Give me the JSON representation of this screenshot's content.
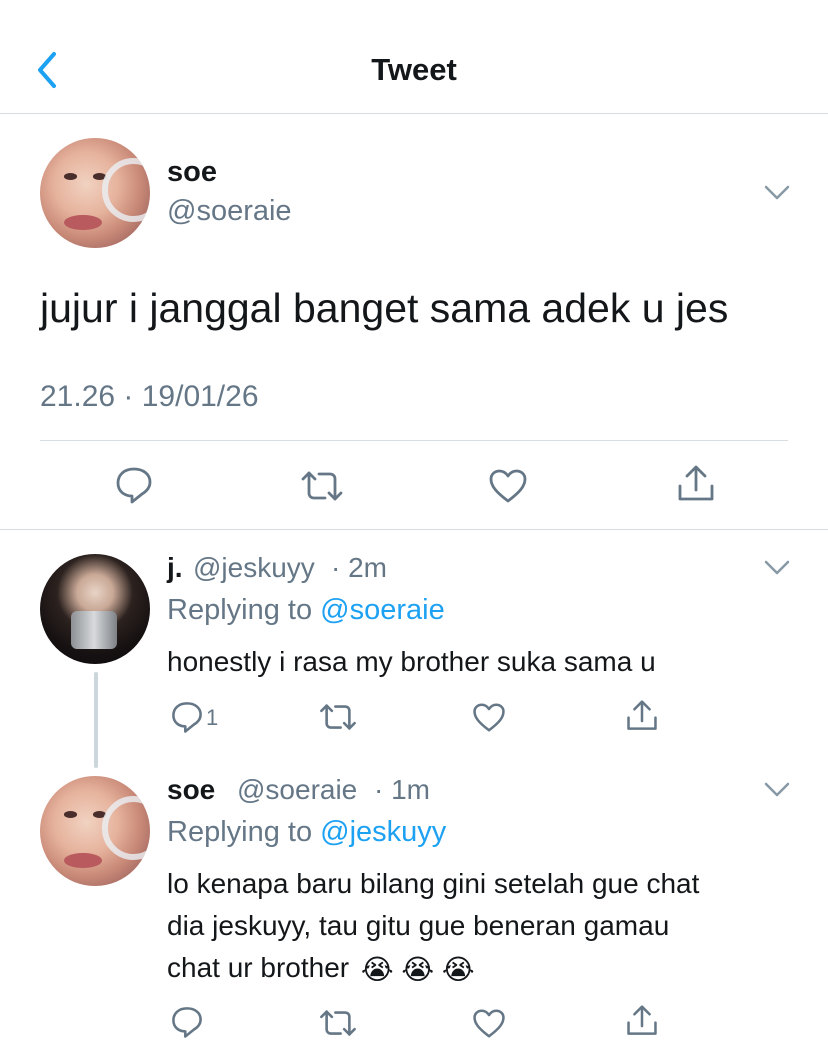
{
  "header": {
    "title": "Tweet"
  },
  "colors": {
    "accent": "#1da1f2",
    "secondary_text": "#657786",
    "divider": "#d8dde1"
  },
  "main_tweet": {
    "name": "soe",
    "handle": "@soeraie",
    "text": "jujur i janggal banget sama adek u jes",
    "timestamp": "21.26 · 19/01/26"
  },
  "replies": [
    {
      "name": "j.",
      "handle": "@jeskuyy",
      "time": "· 2m",
      "replying_label": "Replying to",
      "replying_to": "@soeraie",
      "lines": [
        "honestly i rasa my brother suka sama u"
      ],
      "reply_count": "1"
    },
    {
      "name": "soe",
      "handle": "@soeraie",
      "time": "· 1m",
      "replying_label": "Replying to",
      "replying_to": "@jeskuyy",
      "lines": [
        "lo kenapa baru bilang gini setelah gue chat",
        "dia jeskuyy, tau gitu gue beneran gamau",
        "chat ur brother"
      ],
      "emojis": "😭 😭 😭"
    }
  ]
}
